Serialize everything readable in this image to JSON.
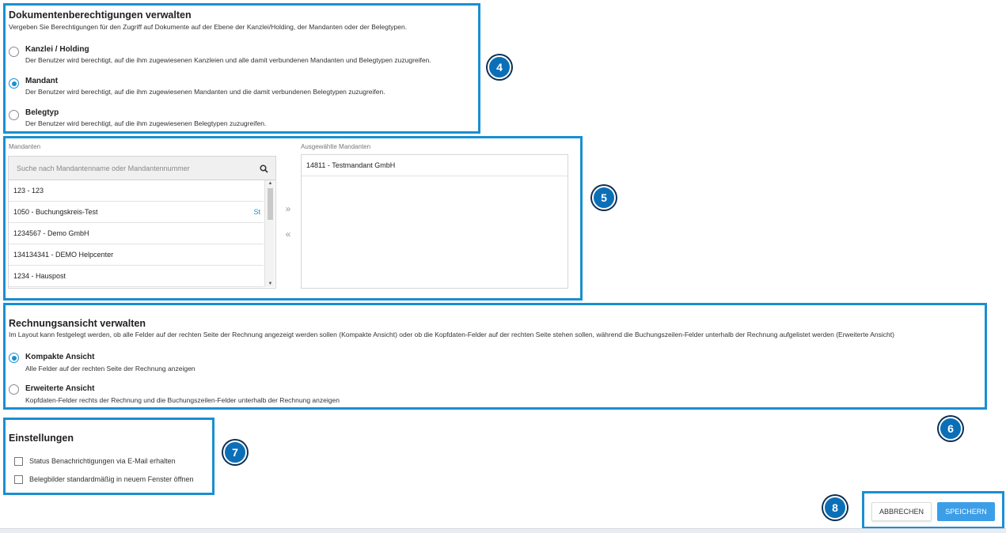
{
  "doc_permissions": {
    "title": "Dokumentenberechtigungen verwalten",
    "subtitle": "Vergeben Sie Berechtigungen für den Zugriff auf Dokumente auf der Ebene der Kanzlei/Holding, der Mandanten oder der Belegtypen.",
    "options": [
      {
        "label": "Kanzlei / Holding",
        "desc": "Der Benutzer wird berechtigt, auf die ihm zugewiesenen Kanzleien und alle damit verbundenen Mandanten und Belegtypen zuzugreifen.",
        "checked": false
      },
      {
        "label": "Mandant",
        "desc": "Der Benutzer wird berechtigt, auf die ihm zugewiesenen Mandanten und die damit verbundenen Belegtypen zuzugreifen.",
        "checked": true
      },
      {
        "label": "Belegtyp",
        "desc": "Der Benutzer wird berechtigt, auf die ihm zugewiesenen Belegtypen zuzugreifen.",
        "checked": false
      }
    ]
  },
  "mandanten": {
    "label": "Mandanten",
    "search_placeholder": "Suche nach Mandantenname oder Mandantennummer",
    "items": [
      {
        "text": "123 - 123",
        "tag": ""
      },
      {
        "text": "1050 - Buchungskreis-Test",
        "tag": "St"
      },
      {
        "text": "1234567 - Demo GmbH",
        "tag": ""
      },
      {
        "text": "134134341 - DEMO Helpcenter",
        "tag": ""
      },
      {
        "text": "1234 - Hauspost",
        "tag": ""
      }
    ],
    "move_right": "»",
    "move_left": "«",
    "selected_label": "Ausgewählte Mandanten",
    "selected_items": [
      {
        "text": "14811 - Testmandant GmbH"
      }
    ]
  },
  "invoice_view": {
    "title": "Rechnungsansicht verwalten",
    "subtitle": "Im Layout kann festgelegt werden, ob alle Felder auf der rechten Seite der Rechnung angezeigt werden sollen (Kompakte Ansicht) oder ob die Kopfdaten-Felder auf der rechten Seite stehen sollen, während die Buchungszeilen-Felder unterhalb der Rechnung aufgelistet werden (Erweiterte Ansicht)",
    "options": [
      {
        "label": "Kompakte Ansicht",
        "desc": "Alle Felder auf der rechten Seite der Rechnung anzeigen",
        "checked": true
      },
      {
        "label": "Erweiterte Ansicht",
        "desc": "Kopfdaten-Felder rechts der Rechnung und die Buchungszeilen-Felder unterhalb der Rechnung anzeigen",
        "checked": false
      }
    ]
  },
  "settings": {
    "title": "Einstellungen",
    "checkboxes": [
      {
        "label": "Status Benachrichtigungen via E-Mail erhalten",
        "checked": false
      },
      {
        "label": "Belegbilder standardmäßig in neuem Fenster öffnen",
        "checked": false
      }
    ]
  },
  "actions": {
    "cancel": "ABBRECHEN",
    "save": "SPEICHERN"
  },
  "annotations": {
    "badge_4": "4",
    "badge_5": "5",
    "badge_6": "6",
    "badge_7": "7",
    "badge_8": "8",
    "highlight_color": "#1a8fd1"
  }
}
